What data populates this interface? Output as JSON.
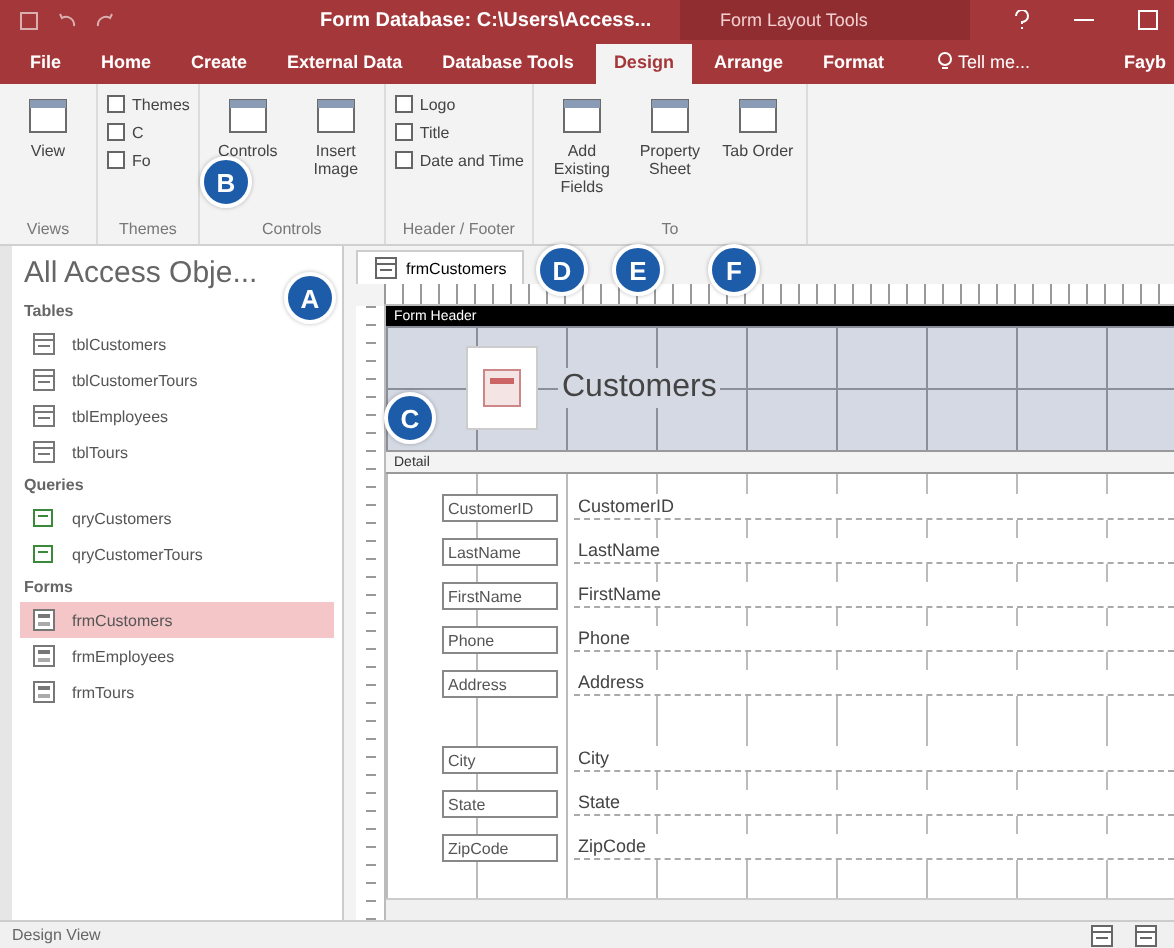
{
  "window": {
    "title": "Form Database: C:\\Users\\Access...",
    "context_title": "Form Layout Tools"
  },
  "ribbon_tabs": [
    {
      "label": "File",
      "selected": false
    },
    {
      "label": "Home",
      "selected": false
    },
    {
      "label": "Create",
      "selected": false
    },
    {
      "label": "External Data",
      "selected": false
    },
    {
      "label": "Database Tools",
      "selected": false
    },
    {
      "label": "Design",
      "selected": true
    },
    {
      "label": "Arrange",
      "selected": false
    },
    {
      "label": "Format",
      "selected": false
    }
  ],
  "tell_me": "Tell me...",
  "user": "Fayb",
  "ribbon_groups": [
    {
      "label": "Views",
      "commands": [
        {
          "label": "View",
          "kind": "large"
        }
      ]
    },
    {
      "label": "Themes",
      "commands": [
        {
          "label": "Themes",
          "kind": "small"
        },
        {
          "label": "C",
          "kind": "small"
        },
        {
          "label": "Fo",
          "kind": "small"
        }
      ]
    },
    {
      "label": "Controls",
      "commands": [
        {
          "label": "Controls",
          "kind": "large"
        },
        {
          "label": "Insert Image",
          "kind": "large"
        }
      ]
    },
    {
      "label": "Header / Footer",
      "commands": [
        {
          "label": "Logo",
          "kind": "small"
        },
        {
          "label": "Title",
          "kind": "small"
        },
        {
          "label": "Date and Time",
          "kind": "small"
        }
      ]
    },
    {
      "label": "To",
      "commands": [
        {
          "label": "Add Existing Fields",
          "kind": "large"
        },
        {
          "label": "Property Sheet",
          "kind": "large"
        },
        {
          "label": "Tab Order",
          "kind": "large"
        }
      ]
    }
  ],
  "nav": {
    "title": "All Access Obje...",
    "sections": [
      {
        "label": "Tables",
        "items": [
          {
            "label": "tblCustomers",
            "kind": "table",
            "selected": false
          },
          {
            "label": "tblCustomerTours",
            "kind": "table",
            "selected": false
          },
          {
            "label": "tblEmployees",
            "kind": "table",
            "selected": false
          },
          {
            "label": "tblTours",
            "kind": "table",
            "selected": false
          }
        ]
      },
      {
        "label": "Queries",
        "items": [
          {
            "label": "qryCustomers",
            "kind": "query",
            "selected": false
          },
          {
            "label": "qryCustomerTours",
            "kind": "query",
            "selected": false
          }
        ]
      },
      {
        "label": "Forms",
        "items": [
          {
            "label": "frmCustomers",
            "kind": "form",
            "selected": true
          },
          {
            "label": "frmEmployees",
            "kind": "form",
            "selected": false
          },
          {
            "label": "frmTours",
            "kind": "form",
            "selected": false
          }
        ]
      }
    ]
  },
  "document_tab": "frmCustomers",
  "form": {
    "header_band": "Form Header",
    "title": "Customers",
    "detail_band": "Detail",
    "fields": [
      {
        "label": "CustomerID",
        "control": "CustomerID"
      },
      {
        "label": "LastName",
        "control": "LastName"
      },
      {
        "label": "FirstName",
        "control": "FirstName"
      },
      {
        "label": "Phone",
        "control": "Phone"
      },
      {
        "label": "Address",
        "control": "Address"
      },
      {
        "label": "City",
        "control": "City"
      },
      {
        "label": "State",
        "control": "State"
      },
      {
        "label": "ZipCode",
        "control": "ZipCode"
      }
    ]
  },
  "status_bar": "Design View",
  "callouts": [
    {
      "letter": "A"
    },
    {
      "letter": "B"
    },
    {
      "letter": "C"
    },
    {
      "letter": "D"
    },
    {
      "letter": "E"
    },
    {
      "letter": "F"
    }
  ]
}
